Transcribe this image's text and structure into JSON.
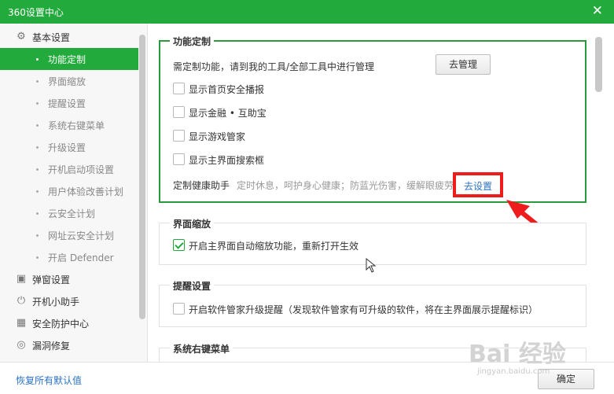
{
  "window": {
    "title": "360设置中心",
    "close_glyph": "✕"
  },
  "sidebar": {
    "groups": [
      {
        "label": "基本设置",
        "icon": "gear-icon"
      },
      {
        "label": "弹窗设置",
        "icon": "popup-icon"
      },
      {
        "label": "开机小助手",
        "icon": "power-icon"
      },
      {
        "label": "安全防护中心",
        "icon": "shield-grid-icon"
      },
      {
        "label": "漏洞修复",
        "icon": "patch-icon"
      }
    ],
    "items": [
      {
        "label": "功能定制",
        "active": true
      },
      {
        "label": "界面缩放"
      },
      {
        "label": "提醒设置"
      },
      {
        "label": "系统右键菜单"
      },
      {
        "label": "升级设置"
      },
      {
        "label": "开机启动项设置"
      },
      {
        "label": "用户体验改善计划"
      },
      {
        "label": "云安全计划"
      },
      {
        "label": "网址云安全计划"
      },
      {
        "label": "开启 Defender"
      }
    ]
  },
  "sections": {
    "custom": {
      "title": "功能定制",
      "desc": "需定制功能，请到我的工具/全部工具中进行管理",
      "manage_button": "去管理",
      "options": [
        {
          "label": "显示首页安全播报",
          "checked": false
        },
        {
          "label": "显示金融 • 互助宝",
          "checked": false
        },
        {
          "label": "显示游戏管家",
          "checked": false
        },
        {
          "label": "显示主界面搜索框",
          "checked": false
        }
      ],
      "health_label": "定制健康助手",
      "health_desc": "定时休息，呵护身心健康；防蓝光伤害，缓解眼疲劳",
      "health_link": "去设置"
    },
    "zoom": {
      "title": "界面缩放",
      "option": {
        "label": "开启主界面自动缩放功能，重新打开生效",
        "checked": true
      }
    },
    "reminder": {
      "title": "提醒设置",
      "option": {
        "label": "开启软件管家升级提醒（发现软件管家有可升级的软件，将在主界面展示提醒标识）",
        "checked": false
      }
    },
    "context_menu": {
      "title": "系统右键菜单"
    }
  },
  "footer": {
    "restore_link": "恢复所有默认值",
    "ok_button": "确定"
  },
  "watermark": {
    "text": "Bai 经验",
    "url": "jingyan.baidu.com"
  },
  "colors": {
    "accent": "#22ab3c",
    "highlight_red": "#ee1c1c",
    "link": "#2a72c6"
  }
}
